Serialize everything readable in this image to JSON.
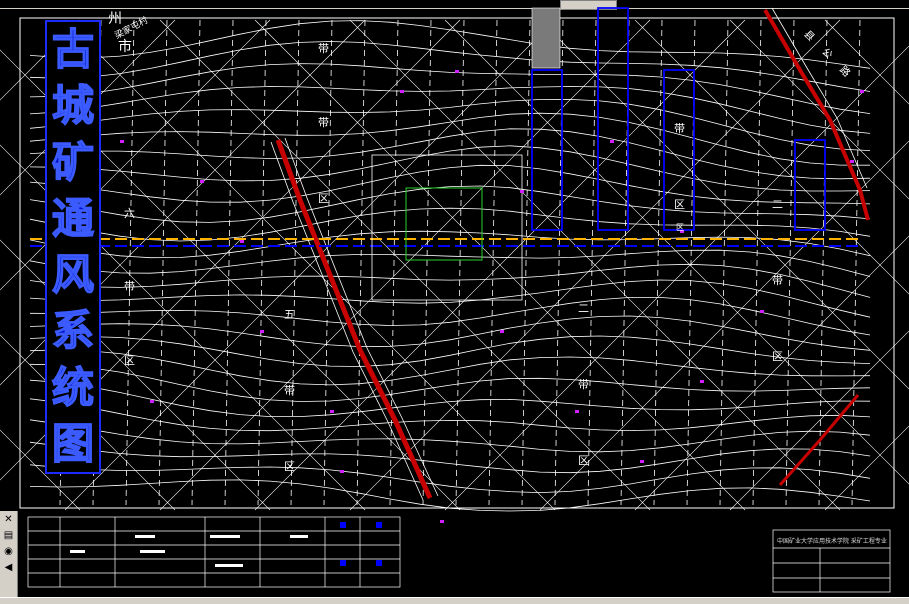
{
  "drawing": {
    "title_chars": [
      "古",
      "城",
      "矿",
      "通",
      "风",
      "系",
      "统",
      "图"
    ],
    "place_labels": [
      "州",
      "市",
      "梁家屯村",
      "六",
      "带",
      "区",
      "五",
      "带",
      "区",
      "带",
      "区",
      "二",
      "带",
      "区",
      "带",
      "区",
      "带",
      "区",
      "二",
      "带",
      "区"
    ],
    "road_label": "县 公 路"
  },
  "title_block": {
    "caption": "中国矿业大学应用技术学院 采矿工程专业"
  },
  "toolbar": {
    "close_glyph": "✕",
    "layer_glyph": "▤",
    "nav_glyph": "◀"
  },
  "colors": {
    "background": "#000000",
    "contour": "#ffffff",
    "title": "#1c2cff",
    "roadway": "#ffb300",
    "fault": "#c80000",
    "workings": "#0000ff"
  }
}
